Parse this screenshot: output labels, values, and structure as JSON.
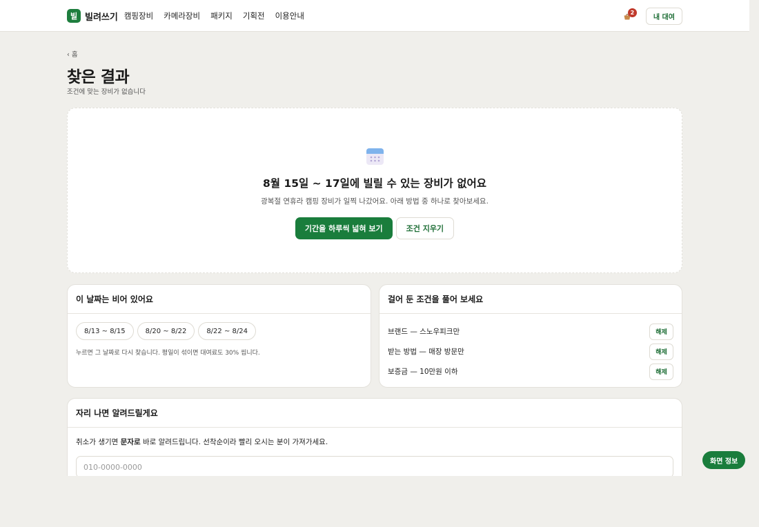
{
  "header": {
    "logo_mark": "빌",
    "logo_text": "빌려쓰기",
    "nav": [
      "캠핑장비",
      "카메라장비",
      "패키지",
      "기획전",
      "이용안내"
    ],
    "cart_count": "2",
    "my_rental_label": "내 대여"
  },
  "page": {
    "breadcrumb": "‹ 홈",
    "title": "찾은 결과",
    "subtitle": "조건에 맞는 장비가 없습니다"
  },
  "empty_state": {
    "icon": "calendar-icon",
    "title": "8월 15일 ~ 17일에 빌릴 수 있는 장비가 없어요",
    "description": "광복절 연휴라 캠핑 장비가 일찍 나갔어요. 아래 방법 중 하나로 찾아보세요.",
    "primary_label": "기간을 하루씩 넓혀 보기",
    "secondary_label": "조건 지우기"
  },
  "alt_dates": {
    "title": "이 날짜는 비어 있어요",
    "chips": [
      "8/13 ~ 8/15",
      "8/20 ~ 8/22",
      "8/22 ~ 8/24"
    ],
    "note": "누르면 그 날짜로 다시 찾습니다. 평일이 섞이면 대여료도 30% 씹니다."
  },
  "filters": {
    "title": "걸어 둔 조건을 풀어 보세요",
    "items": [
      {
        "label": "브랜드 — 스노우피크만",
        "action": "해제"
      },
      {
        "label": "받는 방법 — 매장 방문만",
        "action": "해제"
      },
      {
        "label": "보증금 — 10만원 이하",
        "action": "해제"
      }
    ]
  },
  "notify": {
    "title": "자리 나면 알려드릴게요",
    "desc_before": "취소가 생기면 ",
    "desc_bold": "문자로",
    "desc_after": " 바로 알려드립니다. 선착순이라 빨리 오시는 분이 가져가세요.",
    "phone_placeholder": "010-0000-0000"
  },
  "floating": {
    "screen_info_label": "화면 정보"
  },
  "colors": {
    "primary": "#1a7d3c",
    "background": "#f0efeb",
    "badge": "#c0392b"
  }
}
